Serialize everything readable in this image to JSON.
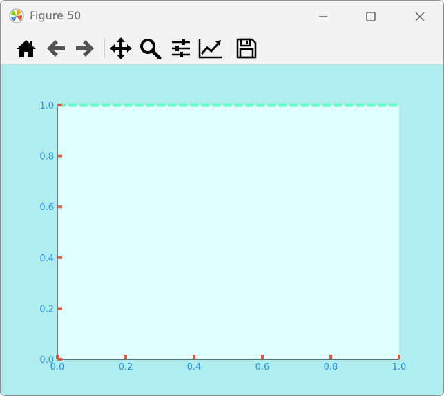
{
  "window": {
    "title": "Figure 50",
    "controls": [
      "minimize-icon",
      "maximize-icon",
      "close-icon"
    ]
  },
  "toolbar": {
    "buttons": [
      {
        "name": "home-button",
        "icon": "home-icon"
      },
      {
        "name": "back-button",
        "icon": "arrow-left-icon"
      },
      {
        "name": "forward-button",
        "icon": "arrow-right-icon"
      },
      {
        "name": "pan-button",
        "icon": "move-icon"
      },
      {
        "name": "zoom-button",
        "icon": "magnifier-icon"
      },
      {
        "name": "configure-subplots-button",
        "icon": "sliders-icon"
      },
      {
        "name": "edit-axes-button",
        "icon": "line-chart-icon"
      },
      {
        "name": "save-button",
        "icon": "floppy-icon"
      }
    ]
  },
  "colors": {
    "figure_background": "#afedee",
    "axes_background": "#e0ffff",
    "tick_mark": "#e8533c",
    "tick_label": "#1e90ff",
    "top_spine": "#66ffcc",
    "spine": "#000000"
  },
  "chart_data": {
    "type": "line",
    "series": [],
    "xlim": [
      0.0,
      1.0
    ],
    "ylim": [
      0.0,
      1.0
    ],
    "xticks": [
      "0.0",
      "0.2",
      "0.4",
      "0.6",
      "0.8",
      "1.0"
    ],
    "yticks": [
      "0.0",
      "0.2",
      "0.4",
      "0.6",
      "0.8",
      "1.0"
    ],
    "grid": false,
    "top_spine_style": "dashed"
  }
}
